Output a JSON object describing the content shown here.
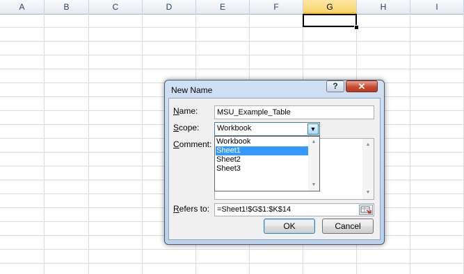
{
  "spreadsheet": {
    "columns": [
      "A",
      "B",
      "C",
      "D",
      "E",
      "F",
      "G",
      "H",
      "I"
    ],
    "active_column": "G"
  },
  "dialog": {
    "title": "New Name",
    "help_label": "?",
    "close_label": "✕",
    "name_label": "Name:",
    "name_label_accel": "N",
    "name_label_rest": "ame:",
    "name_value": "MSU_Example_Table",
    "scope_label_accel": "S",
    "scope_label_rest": "cope:",
    "scope_value": "Workbook",
    "scope_options": [
      "Workbook",
      "Sheet1",
      "Sheet2",
      "Sheet3"
    ],
    "scope_highlighted": "Sheet1",
    "comment_label_accel": "C",
    "comment_label_rest": "omment:",
    "refers_label_accel": "R",
    "refers_label_rest": "efers to:",
    "refers_value": "=Sheet1!$G$1:$K$14",
    "ok_label": "OK",
    "cancel_label": "Cancel"
  }
}
